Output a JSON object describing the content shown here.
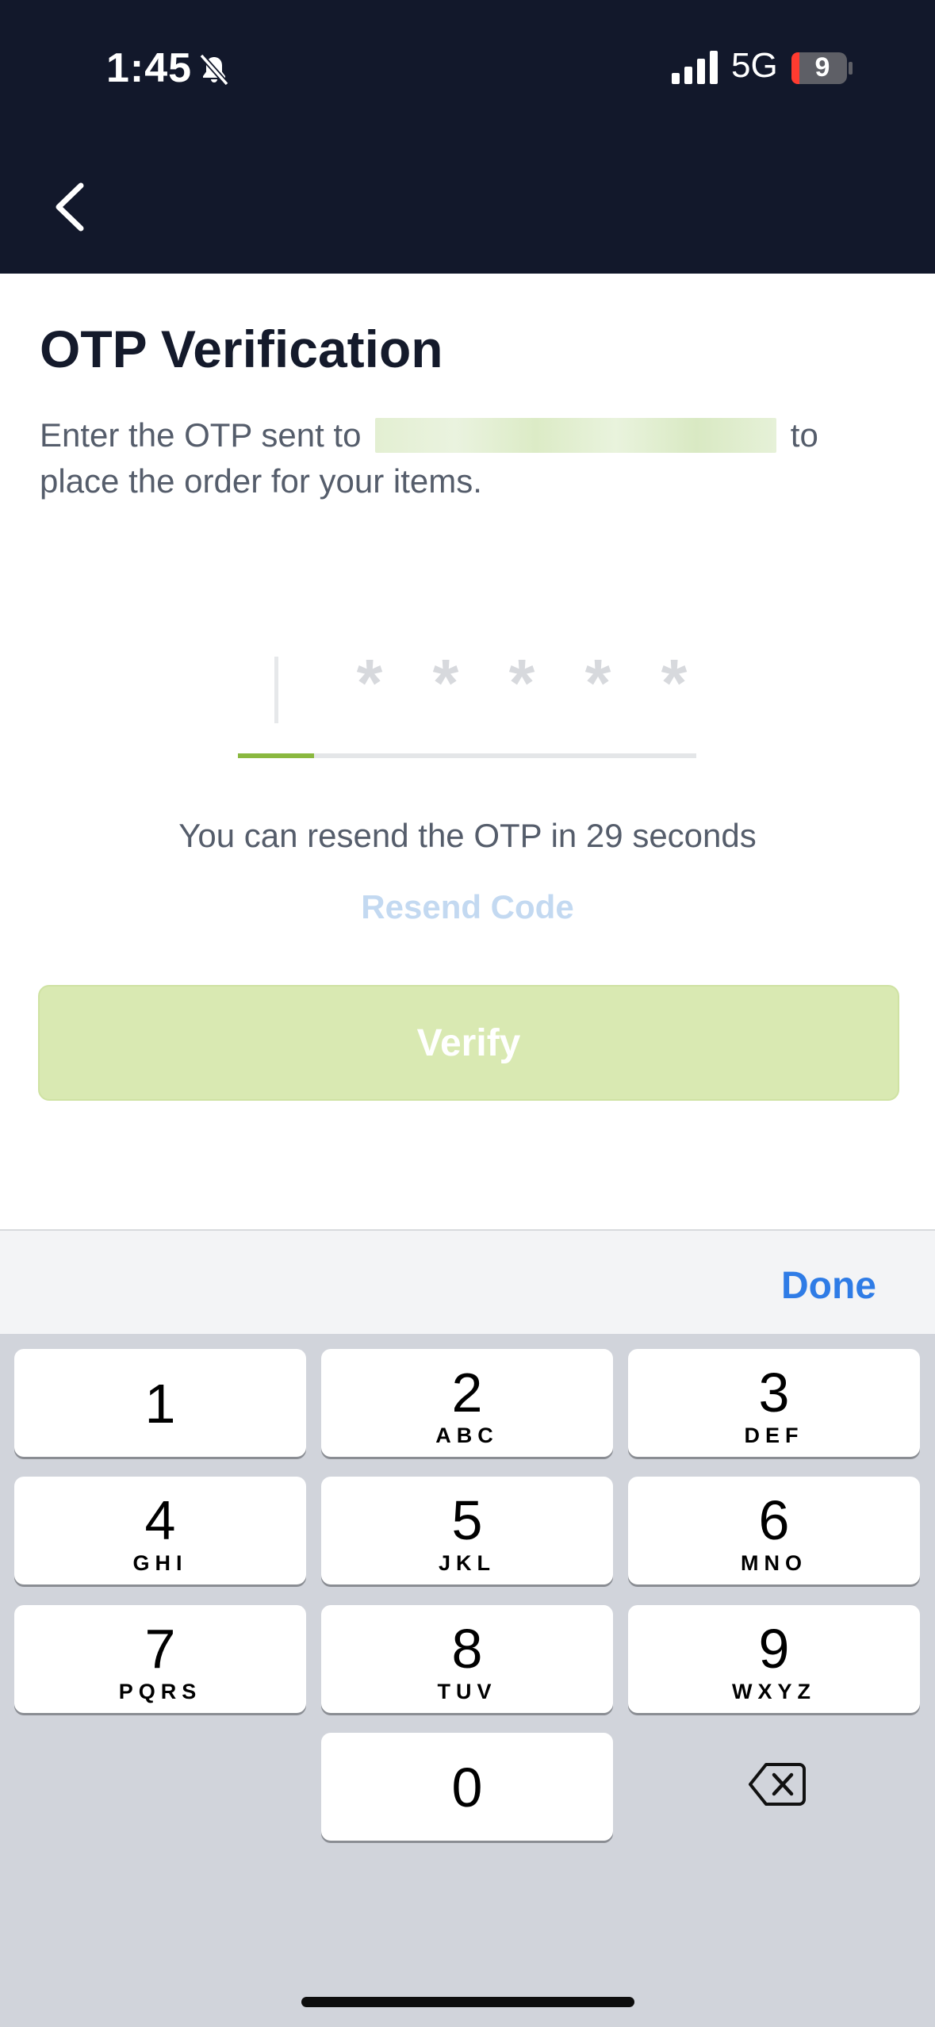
{
  "status_bar": {
    "time": "1:45",
    "network": "5G",
    "battery": "9"
  },
  "page": {
    "title": "OTP Verification",
    "subtitle_before": "Enter the OTP sent to",
    "subtitle_after": "to place the order for your items."
  },
  "otp": {
    "placeholder_char": "*",
    "length": 5,
    "filled": 0
  },
  "resend": {
    "info": "You can resend the OTP in 29 seconds",
    "link": "Resend Code"
  },
  "verify_label": "Verify",
  "keyboard": {
    "done_label": "Done",
    "keys": [
      {
        "num": "1",
        "letters": ""
      },
      {
        "num": "2",
        "letters": "ABC"
      },
      {
        "num": "3",
        "letters": "DEF"
      },
      {
        "num": "4",
        "letters": "GHI"
      },
      {
        "num": "5",
        "letters": "JKL"
      },
      {
        "num": "6",
        "letters": "MNO"
      },
      {
        "num": "7",
        "letters": "PQRS"
      },
      {
        "num": "8",
        "letters": "TUV"
      },
      {
        "num": "9",
        "letters": "WXYZ"
      },
      {
        "num": "0",
        "letters": ""
      }
    ]
  },
  "colors": {
    "header_bg": "#12182b",
    "accent_green": "#8ab83f",
    "verify_disabled": "#d9e9b2",
    "link_disabled": "#c3d9f1",
    "done_blue": "#2f7ce6"
  },
  "icons": [
    "bell-slash-icon",
    "cellular-signal-icon",
    "battery-icon",
    "chevron-left-icon",
    "backspace-icon"
  ]
}
